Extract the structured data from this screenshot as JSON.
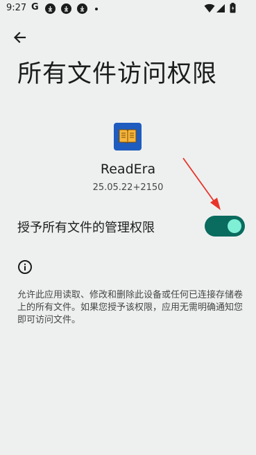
{
  "status_bar": {
    "time": "9:27",
    "g_label": "G",
    "icons": [
      "google-icon",
      "download-icon",
      "download-icon",
      "download-icon",
      "dot",
      "wifi-icon",
      "signal-icon",
      "battery-icon"
    ]
  },
  "header": {
    "back_icon": "arrow-left-icon",
    "title": "所有文件访问权限"
  },
  "app": {
    "icon": "readera-book-icon",
    "name": "ReadEra",
    "version": "25.05.22+2150"
  },
  "permission": {
    "label": "授予所有文件的管理权限",
    "enabled": true
  },
  "info": {
    "icon": "info-icon",
    "description": "允许此应用读取、修改和删除此设备或任何已连接存储卷上的所有文件。如果您授予该权限，应用无需明确通知您即可访问文件。"
  },
  "colors": {
    "background": "#eef0ef",
    "toggle_track": "#0a6b5f",
    "toggle_thumb": "#7ff0d6",
    "app_icon_bg": "#1e5cbf",
    "annotation_arrow": "#e8342b"
  }
}
